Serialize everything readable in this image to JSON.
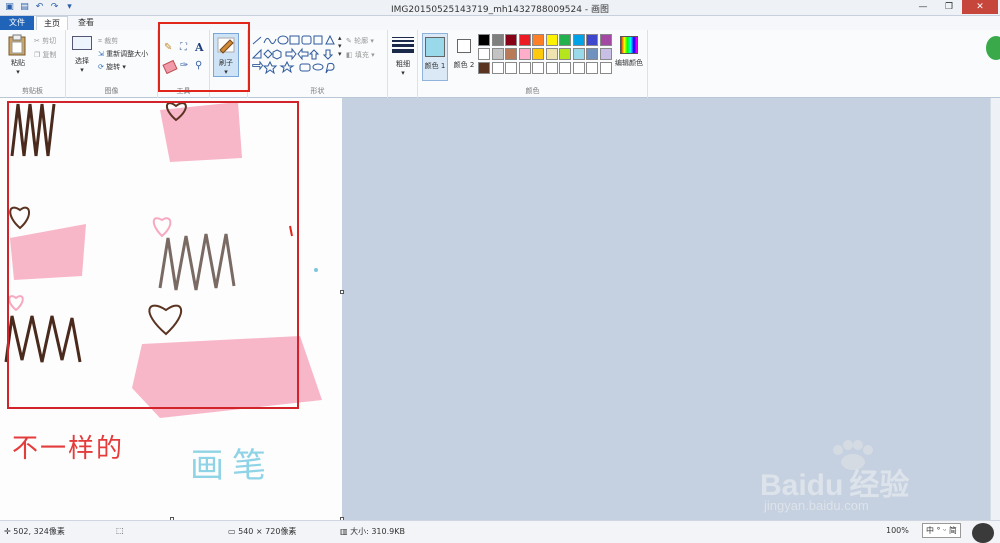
{
  "window": {
    "title": "IMG20150525143719_mh1432788009524 - 画图",
    "min_label": "—",
    "max_label": "❐",
    "close_label": "✕"
  },
  "menu": {
    "file": "文件",
    "home": "主页",
    "view": "查看"
  },
  "ribbon": {
    "clipboard": {
      "paste": "粘贴",
      "cut": "剪切",
      "copy": "复制",
      "group_label": "剪贴板"
    },
    "image": {
      "select": "选择",
      "crop": "裁剪",
      "resize": "重新调整大小",
      "rotate": "旋转",
      "group_label": "图像"
    },
    "tools": {
      "group_label": "工具"
    },
    "brushes": {
      "label": "刷子"
    },
    "shapes": {
      "outline": "轮廓",
      "fill": "填充",
      "group_label": "形状"
    },
    "size": {
      "label": "粗细"
    },
    "colors": {
      "color1": "颜色 1",
      "color2": "颜色 2",
      "edit": "编辑颜色",
      "group_label": "颜色",
      "palette_row1": [
        "#000000",
        "#7f7f7f",
        "#880015",
        "#ed1c24",
        "#ff7f27",
        "#fff200",
        "#22b14c",
        "#00a2e8",
        "#3f48cc",
        "#a349a4"
      ],
      "palette_row2": [
        "#ffffff",
        "#c3c3c3",
        "#b97a57",
        "#ffaec9",
        "#ffc90e",
        "#efe4b0",
        "#b5e61d",
        "#99d9ea",
        "#7092be",
        "#c8bfe7"
      ],
      "palette_row3": [
        "#5a3321",
        "#ffffff",
        "#ffffff",
        "#ffffff",
        "#ffffff",
        "#ffffff",
        "#ffffff",
        "#ffffff",
        "#ffffff",
        "#ffffff"
      ],
      "color1_value": "#99d9ea",
      "color2_value": "#ffffff"
    }
  },
  "canvas_text": {
    "handwriting_red": "不一样的",
    "handwriting_blue": "画笔"
  },
  "status": {
    "cursor": "502, 324像素",
    "dimensions": "540 × 720像素",
    "file_size": "大小: 310.9KB",
    "zoom": "100%",
    "ime": "中 ° ᵕ 简"
  },
  "watermark": {
    "brand": "Baidu",
    "brand_cn": "经验",
    "url": "jingyan.baidu.com"
  }
}
